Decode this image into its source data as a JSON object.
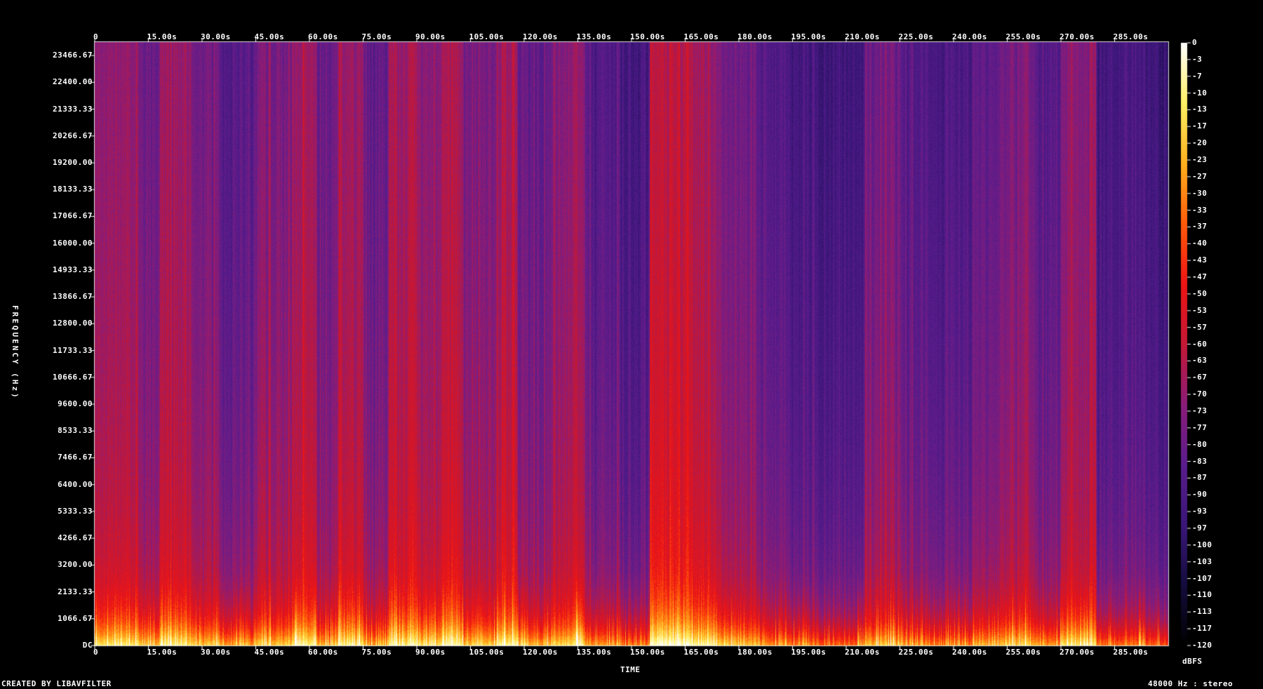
{
  "chart_data": {
    "type": "heatmap",
    "title": "",
    "xlabel": "TIME",
    "ylabel": "FREQUENCY (Hz)",
    "x_ticks": [
      "0",
      "15.00s",
      "30.00s",
      "45.00s",
      "60.00s",
      "75.00s",
      "90.00s",
      "105.00s",
      "120.00s",
      "135.00s",
      "150.00s",
      "165.00s",
      "180.00s",
      "195.00s",
      "210.00s",
      "225.00s",
      "240.00s",
      "255.00s",
      "270.00s",
      "285.00s"
    ],
    "x_tick_values": [
      0,
      15,
      30,
      45,
      60,
      75,
      90,
      105,
      120,
      135,
      150,
      165,
      180,
      195,
      210,
      225,
      240,
      255,
      270,
      285
    ],
    "xlim": [
      0,
      300
    ],
    "y_ticks": [
      "DC",
      "1066.67",
      "2133.33",
      "3200.00",
      "4266.67",
      "5333.33",
      "6400.00",
      "7466.67",
      "8533.33",
      "9600.00",
      "10666.67",
      "11733.33",
      "12800.00",
      "13866.67",
      "14933.33",
      "16000.00",
      "17066.67",
      "18133.33",
      "19200.00",
      "20266.67",
      "21333.33",
      "22400.00",
      "23466.67"
    ],
    "y_tick_values": [
      0,
      1066.67,
      2133.33,
      3200,
      4266.67,
      5333.33,
      6400,
      7466.67,
      8533.33,
      9600,
      10666.67,
      11733.33,
      12800,
      13866.67,
      14933.33,
      16000,
      17066.67,
      18133.33,
      19200,
      20266.67,
      21333.33,
      22400,
      23466.67
    ],
    "ylim": [
      0,
      24000
    ],
    "colorbar_label": "dBFS",
    "colorbar_ticks": [
      "0",
      "-3",
      "-7",
      "-10",
      "-13",
      "-17",
      "-20",
      "-23",
      "-27",
      "-30",
      "-33",
      "-37",
      "-40",
      "-43",
      "-47",
      "-50",
      "-53",
      "-57",
      "-60",
      "-63",
      "-67",
      "-70",
      "-73",
      "-77",
      "-80",
      "-83",
      "-87",
      "-90",
      "-93",
      "-97",
      "-100",
      "-103",
      "-107",
      "-110",
      "-113",
      "-117",
      "-120"
    ],
    "colorbar_range": [
      -120,
      0
    ],
    "colormap": [
      "#000000",
      "#140c3c",
      "#3a1678",
      "#5a1c8c",
      "#8a1c78",
      "#c41836",
      "#ee1414",
      "#ff5a0a",
      "#ffb01e",
      "#fff064",
      "#ffffff"
    ],
    "footer_left": "CREATED BY LIBAVFILTER",
    "footer_right": "48000 Hz : stereo",
    "segments_dbfs": [
      {
        "t": [
          0,
          7
        ],
        "level": -65
      },
      {
        "t": [
          7,
          12
        ],
        "level": -62
      },
      {
        "t": [
          12,
          18
        ],
        "level": -72
      },
      {
        "t": [
          18,
          27
        ],
        "level": -62
      },
      {
        "t": [
          27,
          35
        ],
        "level": -72
      },
      {
        "t": [
          35,
          45
        ],
        "level": -78
      },
      {
        "t": [
          45,
          55
        ],
        "level": -70
      },
      {
        "t": [
          55,
          62
        ],
        "level": -62
      },
      {
        "t": [
          62,
          68
        ],
        "level": -75
      },
      {
        "t": [
          68,
          75
        ],
        "level": -60
      },
      {
        "t": [
          75,
          82
        ],
        "level": -75
      },
      {
        "t": [
          82,
          90
        ],
        "level": -60
      },
      {
        "t": [
          90,
          97
        ],
        "level": -65
      },
      {
        "t": [
          97,
          103
        ],
        "level": -58
      },
      {
        "t": [
          103,
          112
        ],
        "level": -70
      },
      {
        "t": [
          112,
          118
        ],
        "level": -60
      },
      {
        "t": [
          118,
          128
        ],
        "level": -75
      },
      {
        "t": [
          128,
          137
        ],
        "level": -66
      },
      {
        "t": [
          137,
          147
        ],
        "level": -80
      },
      {
        "t": [
          147,
          155
        ],
        "level": -85
      },
      {
        "t": [
          155,
          167
        ],
        "level": -55
      },
      {
        "t": [
          167,
          175
        ],
        "level": -62
      },
      {
        "t": [
          175,
          185
        ],
        "level": -72
      },
      {
        "t": [
          185,
          193
        ],
        "level": -78
      },
      {
        "t": [
          193,
          200
        ],
        "level": -84
      },
      {
        "t": [
          200,
          215
        ],
        "level": -86
      },
      {
        "t": [
          215,
          225
        ],
        "level": -72
      },
      {
        "t": [
          225,
          235
        ],
        "level": -80
      },
      {
        "t": [
          235,
          245
        ],
        "level": -84
      },
      {
        "t": [
          245,
          253
        ],
        "level": -76
      },
      {
        "t": [
          253,
          263
        ],
        "level": -70
      },
      {
        "t": [
          263,
          270
        ],
        "level": -80
      },
      {
        "t": [
          270,
          280
        ],
        "level": -66
      },
      {
        "t": [
          280,
          291
        ],
        "level": -84
      },
      {
        "t": [
          291,
          300
        ],
        "level": -86
      }
    ]
  }
}
